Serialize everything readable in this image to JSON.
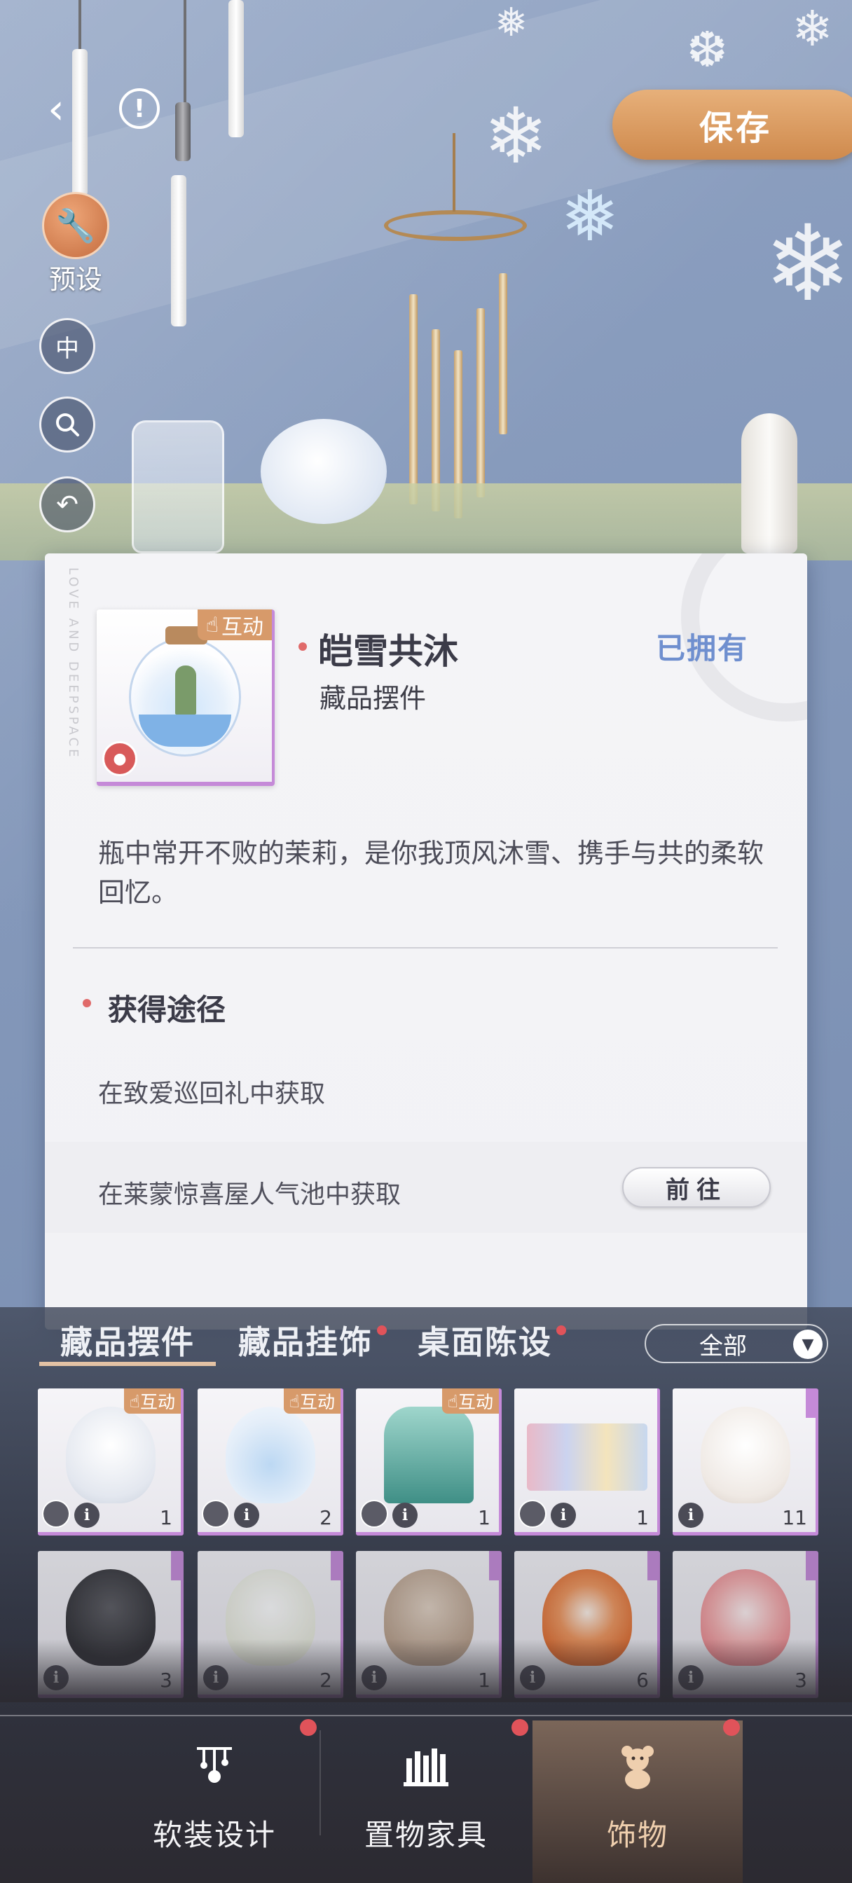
{
  "toolbar": {
    "save_label": "保存",
    "preset_label": "预设",
    "center_label": "中"
  },
  "detail": {
    "interact_tag": "互动",
    "title": "皑雪共沐",
    "owned_status": "已拥有",
    "category": "藏品摆件",
    "description": "瓶中常开不败的茉莉，是你我顶风沐雪、携手与共的柔软回忆。",
    "deco_text": "LOVE AND DEEPSPACE",
    "acquire_title": "获得途径",
    "sources": [
      {
        "text": "在致爱巡回礼中获取"
      },
      {
        "text": "在莱蒙惊喜屋人气池中获取",
        "button": "前往"
      }
    ]
  },
  "inventory": {
    "tabs": [
      {
        "label": "藏品摆件",
        "active": true
      },
      {
        "label": "藏品挂饰",
        "active": false
      },
      {
        "label": "桌面陈设",
        "active": false
      }
    ],
    "filter_value": "全部",
    "items_row1": [
      {
        "tag": "互动",
        "count": "1",
        "color": "#e9edf5"
      },
      {
        "tag": "互动",
        "count": "2",
        "color": "#dbe9f6"
      },
      {
        "tag": "互动",
        "count": "1",
        "color": "#6ab4a5"
      },
      {
        "tag": "",
        "count": "1",
        "color": "#d8d3de"
      },
      {
        "tag": "",
        "count": "11",
        "color": "#f2eeea"
      }
    ],
    "items_row2": [
      {
        "count": "3",
        "color": "#3a3a3e"
      },
      {
        "count": "2",
        "color": "#eef0e6"
      },
      {
        "count": "1",
        "color": "#b9a08a"
      },
      {
        "count": "6",
        "color": "#e8793b"
      },
      {
        "count": "3",
        "color": "#f2a3a3"
      }
    ]
  },
  "nav": {
    "items": [
      {
        "label": "软装设计",
        "icon": "chandelier-icon"
      },
      {
        "label": "置物家具",
        "icon": "bookshelf-icon"
      },
      {
        "label": "饰物",
        "icon": "teddy-bear-icon",
        "active": true
      }
    ]
  }
}
